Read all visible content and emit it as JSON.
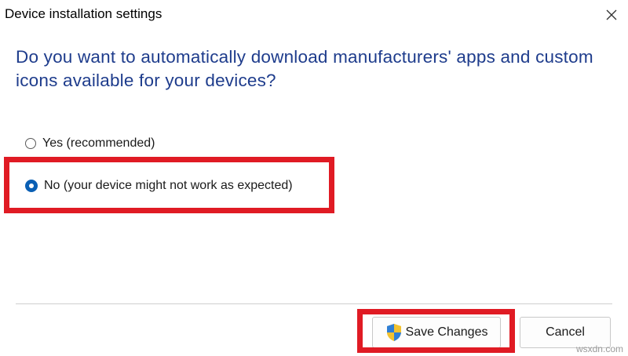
{
  "window": {
    "title": "Device installation settings",
    "close_icon": "close-icon"
  },
  "question": "Do you want to automatically download manufacturers' apps and custom icons available for your devices?",
  "options": [
    {
      "label": "Yes (recommended)",
      "selected": false
    },
    {
      "label": "No (your device might not work as expected)",
      "selected": true
    }
  ],
  "buttons": {
    "save_label": "Save Changes",
    "save_icon": "uac-shield-icon",
    "cancel_label": "Cancel"
  },
  "watermark": "wsxdn.com",
  "colors": {
    "question_text": "#1e3c8c",
    "radio_selected": "#0a5fb4",
    "highlight": "#e01b24"
  }
}
